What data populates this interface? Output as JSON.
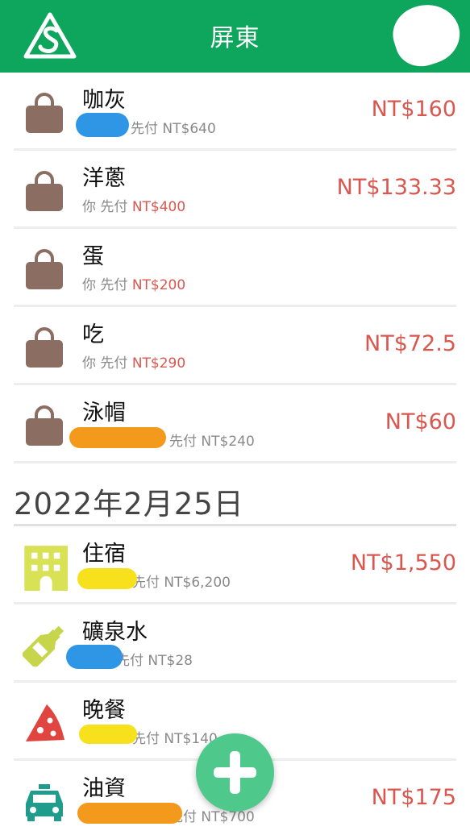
{
  "header": {
    "title": "屏東",
    "logo_icon": "splitwise-logo-icon",
    "accent_color": "#0ea55c"
  },
  "expenses_before": [
    {
      "title": "咖灰",
      "payer_suffix": "先付 NT$640",
      "amount": "NT$160",
      "icon": "shopping-bag-icon"
    },
    {
      "title": "洋蔥",
      "payer_prefix": "你 先付 ",
      "payer_amount": "NT$400",
      "amount": "NT$133.33",
      "icon": "shopping-bag-icon"
    },
    {
      "title": "蛋",
      "payer_prefix": "你 先付 ",
      "payer_amount": "NT$200",
      "amount": "",
      "icon": "shopping-bag-icon"
    },
    {
      "title": "吃",
      "payer_prefix": "你 先付 ",
      "payer_amount": "NT$290",
      "amount": "NT$72.5",
      "icon": "shopping-bag-icon"
    },
    {
      "title": "泳帽",
      "payer_suffix": "先付 NT$240",
      "amount": "NT$60",
      "icon": "shopping-bag-icon"
    }
  ],
  "date_header": "2022年2月25日",
  "expenses_after": [
    {
      "title": "住宿",
      "payer_suffix": "先付 NT$6,200",
      "amount": "NT$1,550",
      "icon": "hotel-icon"
    },
    {
      "title": "礦泉水",
      "payer_suffix": "先付 NT$28",
      "amount": "",
      "icon": "bottle-icon"
    },
    {
      "title": "晚餐",
      "payer_suffix": "先付 NT$140",
      "amount": "",
      "icon": "pizza-icon"
    },
    {
      "title": "油資",
      "payer_suffix": "先付 NT$700",
      "amount": "NT$175",
      "icon": "taxi-icon"
    }
  ],
  "fab": {
    "icon": "plus-icon"
  }
}
